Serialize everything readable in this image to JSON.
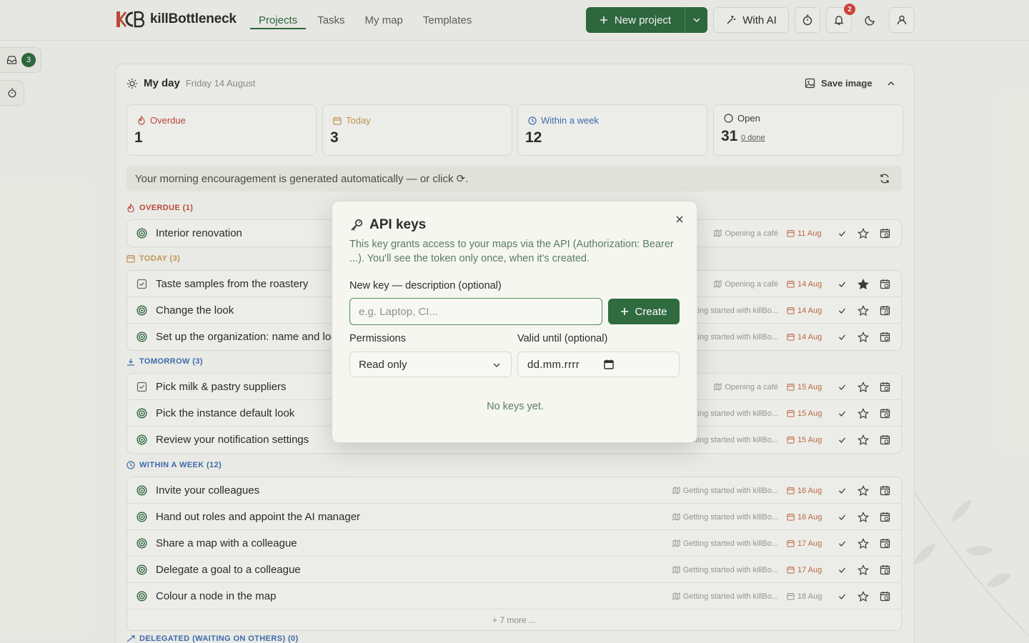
{
  "app": {
    "logo_mark": "KCB",
    "name": "killBottleneck"
  },
  "nav": {
    "tabs": [
      {
        "label": "Projects",
        "active": true
      },
      {
        "label": "Tasks",
        "active": false
      },
      {
        "label": "My map",
        "active": false
      },
      {
        "label": "Templates",
        "active": false
      }
    ]
  },
  "header": {
    "new_project_label": "New project",
    "with_ai_label": "With AI",
    "notification_count": "2",
    "icons": [
      "timer-icon",
      "bell-icon",
      "moon-icon",
      "user-icon"
    ]
  },
  "rail": {
    "inbox_count": "3"
  },
  "myday": {
    "title": "My day",
    "date": "Friday 14 August",
    "save_image_label": "Save image"
  },
  "stats": [
    {
      "label": "Overdue",
      "value": "1",
      "color": "#c44a3a",
      "icon": "flame-icon"
    },
    {
      "label": "Today",
      "value": "3",
      "color": "#c89a52",
      "icon": "calendar-icon"
    },
    {
      "label": "Within a week",
      "value": "12",
      "color": "#3f6fb5",
      "icon": "clock-icon"
    },
    {
      "label": "Open",
      "value": "31",
      "link": "0 done",
      "color": "#5f625a",
      "icon": "circle-icon"
    }
  ],
  "encouragement": "Your morning encouragement is generated automatically — or click ⟳.",
  "sections": [
    {
      "title": "OVERDUE (1)",
      "color": "#c44a3a",
      "rows": [
        {
          "title": "Interior renovation",
          "project": "Opening a café",
          "date": "11 Aug"
        }
      ]
    },
    {
      "title": "TODAY (3)",
      "color": "#c89a52",
      "rows": [
        {
          "title": "Taste samples from the roastery",
          "project": "Opening a café",
          "date": "14 Aug",
          "starred": true
        },
        {
          "title": "Change the look",
          "project": "Getting started with killBo...",
          "date": "14 Aug"
        },
        {
          "title": "Set up the organization: name and logo",
          "project": "Getting started with killBo...",
          "date": "14 Aug"
        }
      ]
    },
    {
      "title": "TOMORROW (3)",
      "color": "#3f6fb5",
      "rows": [
        {
          "title": "Pick milk & pastry suppliers",
          "project": "Opening a café",
          "date": "15 Aug"
        },
        {
          "title": "Pick the instance default look",
          "project": "Getting started with killBo...",
          "date": "15 Aug"
        },
        {
          "title": "Review your notification settings",
          "project": "Getting started with killBo...",
          "date": "15 Aug"
        }
      ]
    },
    {
      "title": "WITHIN A WEEK (12)",
      "color": "#3f6fb5",
      "rows": [
        {
          "title": "Invite your colleagues",
          "project": "Getting started with killBo...",
          "date": "16 Aug"
        },
        {
          "title": "Hand out roles and appoint the AI manager",
          "project": "Getting started with killBo...",
          "date": "16 Aug"
        },
        {
          "title": "Share a map with a colleague",
          "project": "Getting started with killBo...",
          "date": "17 Aug"
        },
        {
          "title": "Delegate a goal to a colleague",
          "project": "Getting started with killBo...",
          "date": "17 Aug"
        },
        {
          "title": "Colour a node in the map",
          "project": "Getting started with killBo...",
          "date": "18 Aug"
        }
      ],
      "more": "+ 7 more ..."
    },
    {
      "title": "DELEGATED (WAITING ON OTHERS) (0)",
      "color": "#3f6fb5"
    }
  ],
  "modal": {
    "title": "API keys",
    "description": "This key grants access to your maps via the API (Authorization: Bearer ...). You'll see the token only once, when it's created.",
    "new_key_label": "New key — description (optional)",
    "new_key_placeholder": "e.g. Laptop, CI...",
    "create_label": "Create",
    "permissions_label": "Permissions",
    "permissions_value": "Read only",
    "valid_until_label": "Valid until (optional)",
    "valid_until_placeholder": "dd.mm.rrrr",
    "empty_text": "No keys yet."
  }
}
